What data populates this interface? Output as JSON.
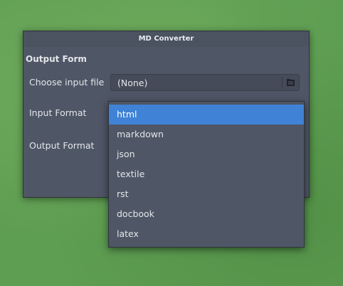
{
  "window": {
    "title": "MD Converter"
  },
  "form": {
    "section_title": "Output Form",
    "input_file_label": "Choose input file",
    "input_file_value": "(None)",
    "input_format_label": "Input Format",
    "output_format_label": "Output Format"
  },
  "dropdown": {
    "items": [
      "html",
      "markdown",
      "json",
      "textile",
      "rst",
      "docbook",
      "latex"
    ],
    "selected": "html"
  },
  "icons": {
    "file_chooser": "folder-icon"
  },
  "colors": {
    "selection": "#3f82d6",
    "window_bg": "#4f5665",
    "desktop_bg": "#5e9e52"
  }
}
